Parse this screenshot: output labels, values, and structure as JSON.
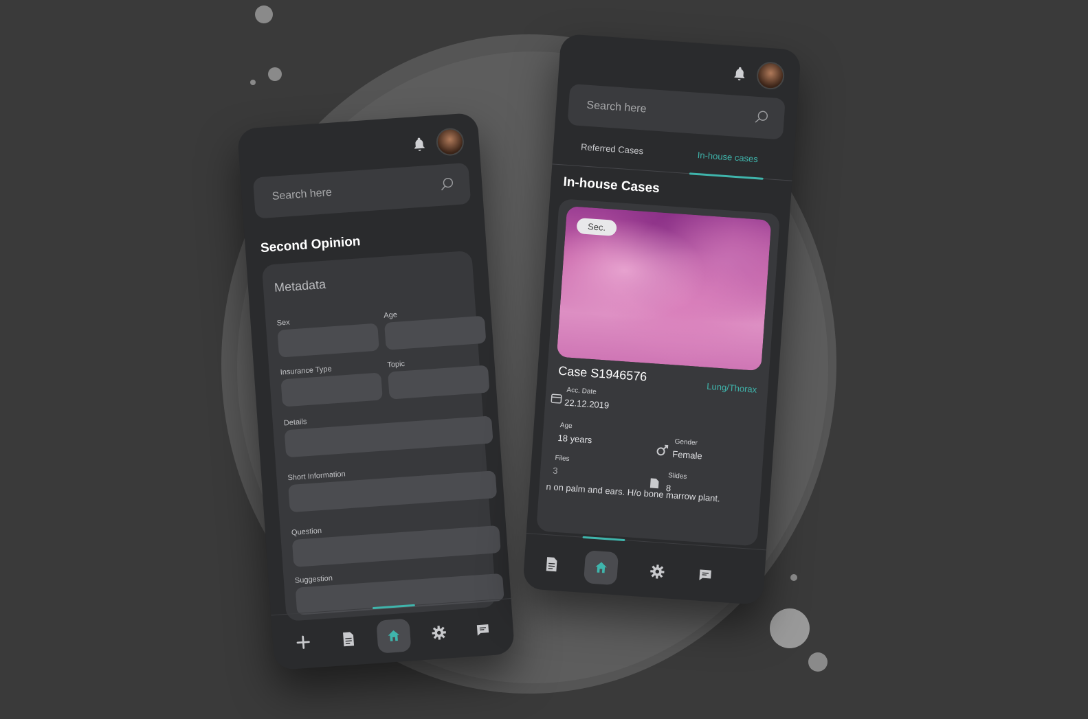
{
  "left_screen": {
    "search_placeholder": "Search here",
    "title": "Second Opinion",
    "metadata": {
      "title": "Metadata",
      "fields": {
        "sex": "Sex",
        "age": "Age",
        "insurance_type": "Insurance Type",
        "topic": "Topic",
        "details": "Details",
        "short_information": "Short Information",
        "question": "Question",
        "suggestion": "Suggestion"
      }
    },
    "nav": {
      "items": [
        "add-icon",
        "document-icon",
        "home-icon",
        "settings-icon",
        "chat-icon"
      ],
      "active": "home-icon"
    }
  },
  "right_screen": {
    "search_placeholder": "Search here",
    "tabs": [
      "Referred Cases",
      "In-house cases"
    ],
    "active_tab": "In-house cases",
    "title": "In-house Cases",
    "case": {
      "tag": "Sec.",
      "id": "Case S1946576",
      "topic": "Lung/Thorax",
      "acc_date_label": "Acc. Date",
      "acc_date": "22.12.2019",
      "age_label": "Age",
      "age": "18 years",
      "gender_label": "Gender",
      "gender": "Female",
      "files_label": "Files",
      "files": "3",
      "slides_label": "Slides",
      "slides": "8",
      "description": "n on palm and ears. H/o bone marrow plant."
    },
    "nav": {
      "items": [
        "document-icon",
        "home-icon",
        "settings-icon",
        "chat-icon"
      ],
      "active": "home-icon"
    }
  },
  "colors": {
    "accent": "#3fb5ac",
    "background": "#3a3a3a",
    "phone": "#2a2b2d",
    "card": "#38393c",
    "field": "#4b4c50"
  }
}
